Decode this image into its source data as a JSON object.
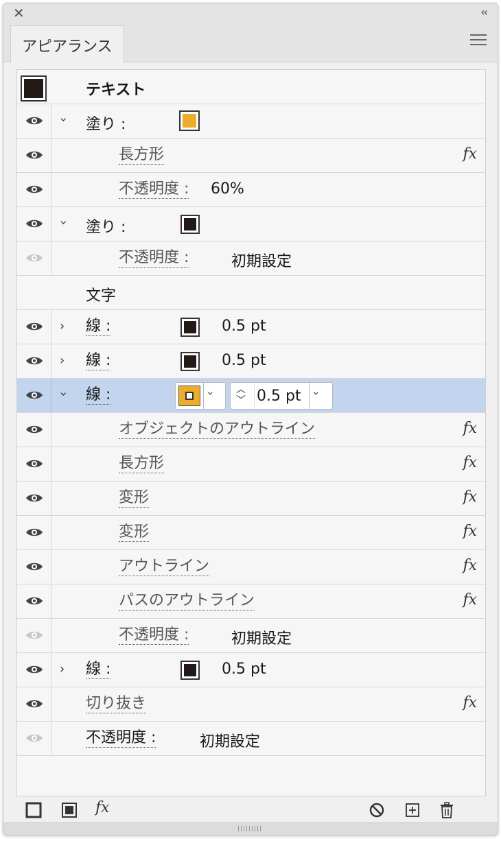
{
  "panel": {
    "tab_label": "アピアランス",
    "close_glyph": "✕",
    "collapse_glyph": "‹‹"
  },
  "header_row": {
    "label": "テキスト"
  },
  "rows": [
    {
      "label": "塗り :",
      "value": "",
      "fx": ""
    },
    {
      "label": "長方形",
      "value": "",
      "fx": "fx"
    },
    {
      "label": "不透明度 :",
      "value": "60%",
      "fx": ""
    },
    {
      "label": "塗り :",
      "value": "",
      "fx": ""
    },
    {
      "label": "不透明度 :",
      "value": "初期設定",
      "fx": ""
    },
    {
      "label": "文字",
      "value": "",
      "fx": ""
    },
    {
      "label": "線 :",
      "value": "0.5 pt",
      "fx": ""
    },
    {
      "label": "線 :",
      "value": "0.5 pt",
      "fx": ""
    },
    {
      "label": "線 :",
      "value": "0.5 pt",
      "fx": ""
    },
    {
      "label": "オブジェクトのアウトライン",
      "value": "",
      "fx": "fx"
    },
    {
      "label": "長方形",
      "value": "",
      "fx": "fx"
    },
    {
      "label": "変形",
      "value": "",
      "fx": "fx"
    },
    {
      "label": "変形",
      "value": "",
      "fx": "fx"
    },
    {
      "label": "アウトライン",
      "value": "",
      "fx": "fx"
    },
    {
      "label": "パスのアウトライン",
      "value": "",
      "fx": "fx"
    },
    {
      "label": "不透明度 :",
      "value": "初期設定",
      "fx": ""
    },
    {
      "label": "線 :",
      "value": "0.5 pt",
      "fx": ""
    },
    {
      "label": "切り抜き",
      "value": "",
      "fx": "fx"
    },
    {
      "label": "不透明度 :",
      "value": "初期設定",
      "fx": ""
    }
  ],
  "footer": {
    "fx_label": "fx"
  },
  "colors": {
    "fill_orange": "#ecac2c",
    "fill_dark": "#231916",
    "selected_row": "#c2d4ee"
  }
}
